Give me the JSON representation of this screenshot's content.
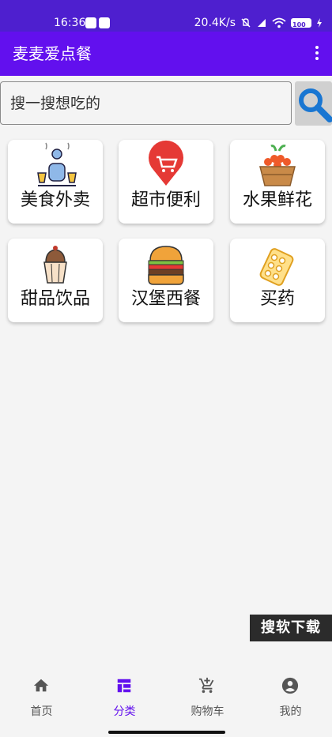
{
  "status_bar": {
    "time": "16:36",
    "network_speed": "20.4K/s",
    "battery": "100"
  },
  "app_bar": {
    "title": "麦麦爱点餐",
    "more_icon": "more-vert-icon"
  },
  "search": {
    "placeholder": "搜一搜想吃的",
    "button_icon": "search-icon"
  },
  "categories": [
    {
      "label": "美食外卖",
      "icon": "food-delivery-icon"
    },
    {
      "label": "超市便利",
      "icon": "shopping-cart-pin-icon"
    },
    {
      "label": "水果鲜花",
      "icon": "fruit-basket-icon"
    },
    {
      "label": "甜品饮品",
      "icon": "cupcake-icon"
    },
    {
      "label": "汉堡西餐",
      "icon": "hamburger-icon"
    },
    {
      "label": "买药",
      "icon": "pill-pack-icon"
    }
  ],
  "watermark": "搜软下载",
  "bottom_nav": {
    "items": [
      {
        "label": "首页",
        "icon": "home-icon"
      },
      {
        "label": "分类",
        "icon": "category-grid-icon"
      },
      {
        "label": "购物车",
        "icon": "cart-add-icon"
      },
      {
        "label": "我的",
        "icon": "account-icon"
      }
    ],
    "active": "分类"
  },
  "colors": {
    "primary": "#6210ee",
    "status_bar": "#4e1fcf",
    "background": "#f4f4f4"
  }
}
